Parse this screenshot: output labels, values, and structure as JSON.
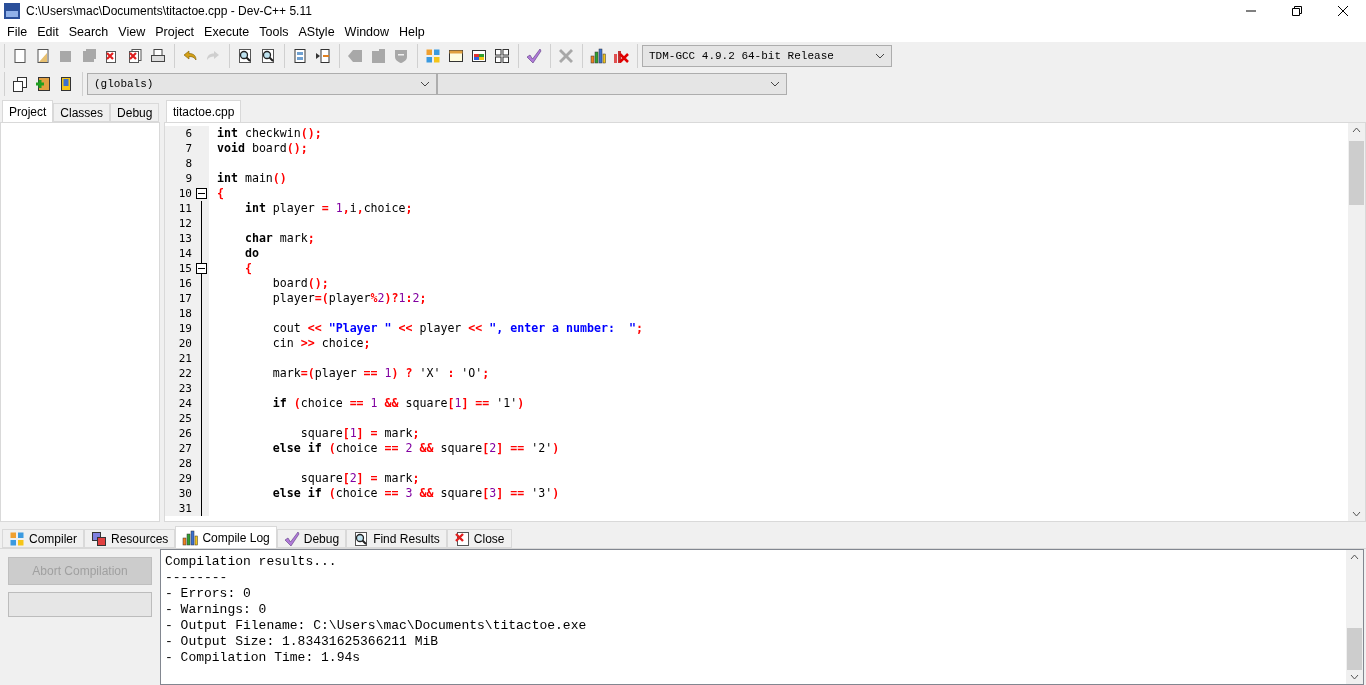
{
  "window": {
    "title": "C:\\Users\\mac\\Documents\\titactoe.cpp - Dev-C++ 5.11"
  },
  "menu": [
    "File",
    "Edit",
    "Search",
    "View",
    "Project",
    "Execute",
    "Tools",
    "AStyle",
    "Window",
    "Help"
  ],
  "toolbar": {
    "groups": [
      [
        {
          "kind": "new",
          "disabled": false
        },
        {
          "kind": "open",
          "disabled": false
        },
        {
          "kind": "save",
          "disabled": true
        },
        {
          "kind": "saveall",
          "disabled": true
        },
        {
          "kind": "close",
          "disabled": false
        },
        {
          "kind": "closeall",
          "disabled": false
        },
        {
          "kind": "print",
          "disabled": false
        }
      ],
      [
        {
          "kind": "undo",
          "disabled": false
        },
        {
          "kind": "redo",
          "disabled": true
        }
      ],
      [
        {
          "kind": "find",
          "disabled": false
        },
        {
          "kind": "replace",
          "disabled": false
        }
      ],
      [
        {
          "kind": "panel",
          "disabled": false
        },
        {
          "kind": "panelarrow",
          "disabled": false
        }
      ],
      [
        {
          "kind": "tagleft",
          "disabled": true
        },
        {
          "kind": "tagright",
          "disabled": true
        },
        {
          "kind": "shield",
          "disabled": true
        }
      ],
      [
        {
          "kind": "grid",
          "disabled": false
        },
        {
          "kind": "window",
          "disabled": false
        },
        {
          "kind": "colorwindow",
          "disabled": false
        },
        {
          "kind": "gridoutline",
          "disabled": false
        }
      ],
      [
        {
          "kind": "check",
          "disabled": false
        }
      ],
      [
        {
          "kind": "cross",
          "disabled": true
        }
      ],
      [
        {
          "kind": "chart",
          "disabled": false
        },
        {
          "kind": "chartcross",
          "disabled": false
        }
      ]
    ],
    "compiler": "TDM-GCC 4.9.2 64-bit Release"
  },
  "toolbar2": {
    "buttons": [
      {
        "kind": "stack",
        "disabled": false
      },
      {
        "kind": "plus",
        "disabled": false
      },
      {
        "kind": "book",
        "disabled": false
      }
    ],
    "scope": "(globals)"
  },
  "left_panel": {
    "tabs": [
      {
        "label": "Project",
        "selected": true
      },
      {
        "label": "Classes",
        "selected": false
      },
      {
        "label": "Debug",
        "selected": false
      }
    ]
  },
  "editor": {
    "tabs": [
      {
        "label": "titactoe.cpp",
        "selected": true
      }
    ],
    "lines": [
      {
        "number": "6",
        "fold": false,
        "tokens": [
          {
            "kind": "keyword",
            "text": "int"
          },
          {
            "kind": "plain",
            "text": " checkwin"
          },
          {
            "kind": "operator",
            "text": "();"
          }
        ]
      },
      {
        "number": "7",
        "fold": false,
        "tokens": [
          {
            "kind": "keyword",
            "text": "void"
          },
          {
            "kind": "plain",
            "text": " board"
          },
          {
            "kind": "operator",
            "text": "();"
          }
        ]
      },
      {
        "number": "8",
        "fold": false
      },
      {
        "number": "9",
        "fold": false,
        "tokens": [
          {
            "kind": "keyword",
            "text": "int"
          },
          {
            "kind": "plain",
            "text": " main"
          },
          {
            "kind": "operator",
            "text": "()"
          }
        ]
      },
      {
        "number": "10",
        "fold": true,
        "tokens": [
          {
            "kind": "operator",
            "text": "{"
          }
        ]
      },
      {
        "number": "11",
        "fold": false,
        "tokens": [
          {
            "kind": "keyword",
            "text": "    int"
          },
          {
            "kind": "plain",
            "text": " player "
          },
          {
            "kind": "operator",
            "text": "= "
          },
          {
            "kind": "number",
            "text": "1"
          },
          {
            "kind": "operator",
            "text": ","
          },
          {
            "kind": "plain",
            "text": "i"
          },
          {
            "kind": "operator",
            "text": ","
          },
          {
            "kind": "plain",
            "text": "choice"
          },
          {
            "kind": "operator",
            "text": ";"
          }
        ]
      },
      {
        "number": "12",
        "fold": false
      },
      {
        "number": "13",
        "fold": false,
        "tokens": [
          {
            "kind": "keyword",
            "text": "    char"
          },
          {
            "kind": "plain",
            "text": " mark"
          },
          {
            "kind": "operator",
            "text": ";"
          }
        ]
      },
      {
        "number": "14",
        "fold": false,
        "tokens": [
          {
            "kind": "keyword",
            "text": "    do"
          }
        ]
      },
      {
        "number": "15",
        "fold": true,
        "tokens": [
          {
            "kind": "operator",
            "text": "    {"
          }
        ]
      },
      {
        "number": "16",
        "fold": false,
        "tokens": [
          {
            "kind": "plain",
            "text": "        board"
          },
          {
            "kind": "operator",
            "text": "();"
          }
        ]
      },
      {
        "number": "17",
        "fold": false,
        "tokens": [
          {
            "kind": "plain",
            "text": "        player"
          },
          {
            "kind": "operator",
            "text": "=("
          },
          {
            "kind": "plain",
            "text": "player"
          },
          {
            "kind": "operator",
            "text": "%"
          },
          {
            "kind": "number",
            "text": "2"
          },
          {
            "kind": "operator",
            "text": ")?"
          },
          {
            "kind": "number",
            "text": "1"
          },
          {
            "kind": "operator",
            "text": ":"
          },
          {
            "kind": "number",
            "text": "2"
          },
          {
            "kind": "operator",
            "text": ";"
          }
        ]
      },
      {
        "number": "18",
        "fold": false
      },
      {
        "number": "19",
        "fold": false,
        "tokens": [
          {
            "kind": "plain",
            "text": "        cout "
          },
          {
            "kind": "operator",
            "text": "<< "
          },
          {
            "kind": "string",
            "text": "\"Player \" "
          },
          {
            "kind": "operator",
            "text": "<<"
          },
          {
            "kind": "plain",
            "text": " player "
          },
          {
            "kind": "operator",
            "text": "<< "
          },
          {
            "kind": "string",
            "text": "\", enter a number:  \""
          },
          {
            "kind": "operator",
            "text": ";"
          }
        ]
      },
      {
        "number": "20",
        "fold": false,
        "tokens": [
          {
            "kind": "plain",
            "text": "        cin "
          },
          {
            "kind": "operator",
            "text": ">>"
          },
          {
            "kind": "plain",
            "text": " choice"
          },
          {
            "kind": "operator",
            "text": ";"
          }
        ]
      },
      {
        "number": "21",
        "fold": false
      },
      {
        "number": "22",
        "fold": false,
        "tokens": [
          {
            "kind": "plain",
            "text": "        mark"
          },
          {
            "kind": "operator",
            "text": "=("
          },
          {
            "kind": "plain",
            "text": "player "
          },
          {
            "kind": "operator",
            "text": "== "
          },
          {
            "kind": "number",
            "text": "1"
          },
          {
            "kind": "operator",
            "text": ") ?"
          },
          {
            "kind": "plain",
            "text": " 'X' "
          },
          {
            "kind": "operator",
            "text": ":"
          },
          {
            "kind": "plain",
            "text": " 'O'"
          },
          {
            "kind": "operator",
            "text": ";"
          }
        ]
      },
      {
        "number": "23",
        "fold": false
      },
      {
        "number": "24",
        "fold": false,
        "tokens": [
          {
            "kind": "keyword",
            "text": "        if "
          },
          {
            "kind": "operator",
            "text": "("
          },
          {
            "kind": "plain",
            "text": "choice "
          },
          {
            "kind": "operator",
            "text": "== "
          },
          {
            "kind": "number",
            "text": "1 "
          },
          {
            "kind": "operator",
            "text": "&&"
          },
          {
            "kind": "plain",
            "text": " square"
          },
          {
            "kind": "operator",
            "text": "["
          },
          {
            "kind": "number",
            "text": "1"
          },
          {
            "kind": "operator",
            "text": "] =="
          },
          {
            "kind": "plain",
            "text": " '1'"
          },
          {
            "kind": "operator",
            "text": ")"
          }
        ]
      },
      {
        "number": "25",
        "fold": false
      },
      {
        "number": "26",
        "fold": false,
        "tokens": [
          {
            "kind": "plain",
            "text": "            square"
          },
          {
            "kind": "operator",
            "text": "["
          },
          {
            "kind": "number",
            "text": "1"
          },
          {
            "kind": "operator",
            "text": "] ="
          },
          {
            "kind": "plain",
            "text": " mark"
          },
          {
            "kind": "operator",
            "text": ";"
          }
        ]
      },
      {
        "number": "27",
        "fold": false,
        "tokens": [
          {
            "kind": "keyword",
            "text": "        else if "
          },
          {
            "kind": "operator",
            "text": "("
          },
          {
            "kind": "plain",
            "text": "choice "
          },
          {
            "kind": "operator",
            "text": "== "
          },
          {
            "kind": "number",
            "text": "2 "
          },
          {
            "kind": "operator",
            "text": "&&"
          },
          {
            "kind": "plain",
            "text": " square"
          },
          {
            "kind": "operator",
            "text": "["
          },
          {
            "kind": "number",
            "text": "2"
          },
          {
            "kind": "operator",
            "text": "] =="
          },
          {
            "kind": "plain",
            "text": " '2'"
          },
          {
            "kind": "operator",
            "text": ")"
          }
        ]
      },
      {
        "number": "28",
        "fold": false
      },
      {
        "number": "29",
        "fold": false,
        "tokens": [
          {
            "kind": "plain",
            "text": "            square"
          },
          {
            "kind": "operator",
            "text": "["
          },
          {
            "kind": "number",
            "text": "2"
          },
          {
            "kind": "operator",
            "text": "] ="
          },
          {
            "kind": "plain",
            "text": " mark"
          },
          {
            "kind": "operator",
            "text": ";"
          }
        ]
      },
      {
        "number": "30",
        "fold": false,
        "tokens": [
          {
            "kind": "keyword",
            "text": "        else if "
          },
          {
            "kind": "operator",
            "text": "("
          },
          {
            "kind": "plain",
            "text": "choice "
          },
          {
            "kind": "operator",
            "text": "== "
          },
          {
            "kind": "number",
            "text": "3 "
          },
          {
            "kind": "operator",
            "text": "&&"
          },
          {
            "kind": "plain",
            "text": " square"
          },
          {
            "kind": "operator",
            "text": "["
          },
          {
            "kind": "number",
            "text": "3"
          },
          {
            "kind": "operator",
            "text": "] =="
          },
          {
            "kind": "plain",
            "text": " '3'"
          },
          {
            "kind": "operator",
            "text": ")"
          }
        ]
      },
      {
        "number": "31",
        "fold": false
      }
    ]
  },
  "bottom_panel": {
    "tabs": [
      {
        "label": "Compiler",
        "kind": "compiler",
        "selected": false
      },
      {
        "label": "Resources",
        "kind": "resources",
        "selected": false
      },
      {
        "label": "Compile Log",
        "kind": "log",
        "selected": true
      },
      {
        "label": "Debug",
        "kind": "debug",
        "selected": false
      },
      {
        "label": "Find Results",
        "kind": "find",
        "selected": false
      },
      {
        "label": "Close",
        "kind": "close",
        "selected": false
      }
    ],
    "abort_button": {
      "label": "Abort Compilation",
      "disabled": true
    },
    "progress": {
      "level": 0
    },
    "log": [
      "Compilation results...",
      "--------",
      "- Errors: 0",
      "- Warnings: 0",
      "- Output Filename: C:\\Users\\mac\\Documents\\titactoe.exe",
      "- Output Size: 1.83431625366211 MiB",
      "- Compilation Time: 1.94s"
    ]
  }
}
